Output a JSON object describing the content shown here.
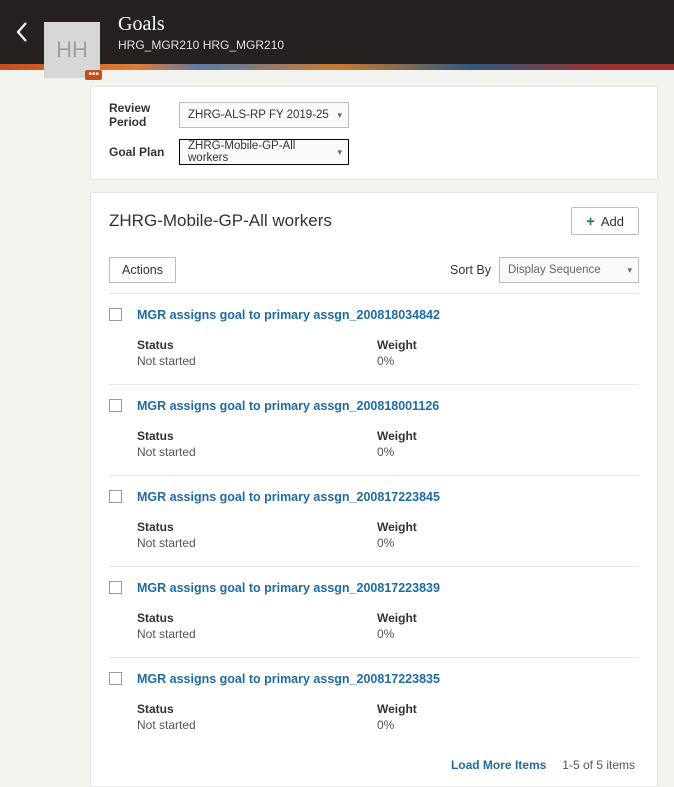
{
  "header": {
    "avatar_initials": "HH",
    "title": "Goals",
    "subtitle": "HRG_MGR210 HRG_MGR210"
  },
  "filters": {
    "review_period_label": "Review Period",
    "review_period_value": "ZHRG-ALS-RP FY 2019-25",
    "goal_plan_label": "Goal Plan",
    "goal_plan_value": "ZHRG-Mobile-GP-All workers"
  },
  "section": {
    "title": "ZHRG-Mobile-GP-All workers",
    "add_label": "Add",
    "actions_label": "Actions",
    "sort_by_label": "Sort By",
    "sort_by_value": "Display Sequence",
    "load_more_label": "Load More Items",
    "count_text": "1-5 of 5 items"
  },
  "field_labels": {
    "status": "Status",
    "weight": "Weight"
  },
  "goals": [
    {
      "title": "MGR assigns goal to primary assgn_200818034842",
      "status": "Not started",
      "weight": "0%"
    },
    {
      "title": "MGR assigns goal to primary assgn_200818001126",
      "status": "Not started",
      "weight": "0%"
    },
    {
      "title": "MGR assigns goal to primary assgn_200817223845",
      "status": "Not started",
      "weight": "0%"
    },
    {
      "title": "MGR assigns goal to primary assgn_200817223839",
      "status": "Not started",
      "weight": "0%"
    },
    {
      "title": "MGR assigns goal to primary assgn_200817223835",
      "status": "Not started",
      "weight": "0%"
    }
  ]
}
